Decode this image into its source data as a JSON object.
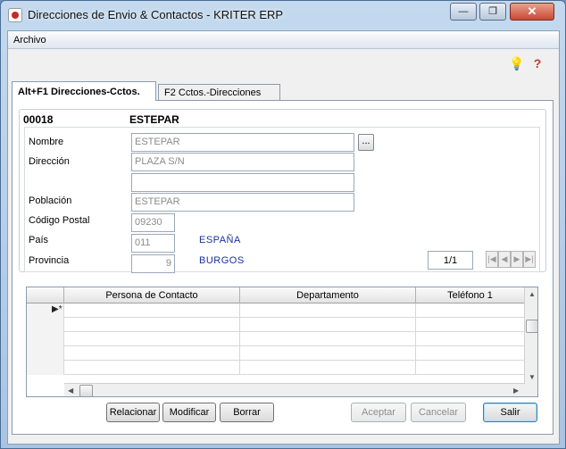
{
  "window": {
    "title": "Direcciones de Envio & Contactos - KRITER ERP",
    "controls": {
      "minimize": "—",
      "maximize": "❐",
      "close": "✕"
    }
  },
  "menubar": {
    "items": [
      {
        "label": "Archivo"
      }
    ]
  },
  "toolbar": {
    "icons": [
      "lightbulb-icon",
      "help-icon"
    ],
    "bulb_glyph": "💡",
    "help_glyph": "?"
  },
  "tabs": [
    {
      "label": "Alt+F1 Direcciones-Cctos.",
      "active": true
    },
    {
      "label": "F2 Cctos.-Direcciones",
      "active": false
    }
  ],
  "record": {
    "code": "00018",
    "name": "ESTEPAR"
  },
  "form": {
    "nombre_label": "Nombre",
    "nombre_value": "ESTEPAR",
    "ellipsis": "...",
    "direccion_label": "Dirección",
    "direccion_value": "PLAZA S/N",
    "direccion2_value": "",
    "poblacion_label": "Población",
    "poblacion_value": "ESTEPAR",
    "cp_label": "Código Postal",
    "cp_value": "09230",
    "pais_label": "País",
    "pais_code": "011",
    "pais_name": "ESPAÑA",
    "provincia_label": "Provincia",
    "provincia_code": "9",
    "provincia_name": "BURGOS"
  },
  "pager": {
    "value": "1/1",
    "first": "|◀",
    "prev": "◀",
    "next": "▶",
    "last": "▶|"
  },
  "grid": {
    "columns": [
      "Persona de Contacto",
      "Departamento",
      "Teléfono 1"
    ],
    "rows": [],
    "new_row_marker": "▶*"
  },
  "buttons": {
    "relacionar": "Relacionar",
    "modificar": "Modificar",
    "borrar": "Borrar",
    "aceptar": "Aceptar",
    "cancelar": "Cancelar",
    "salir": "Salir"
  },
  "colors": {
    "accent_text": "#1a2f9e",
    "title_bar": "#b7cde6",
    "close_button": "#c84a33"
  }
}
